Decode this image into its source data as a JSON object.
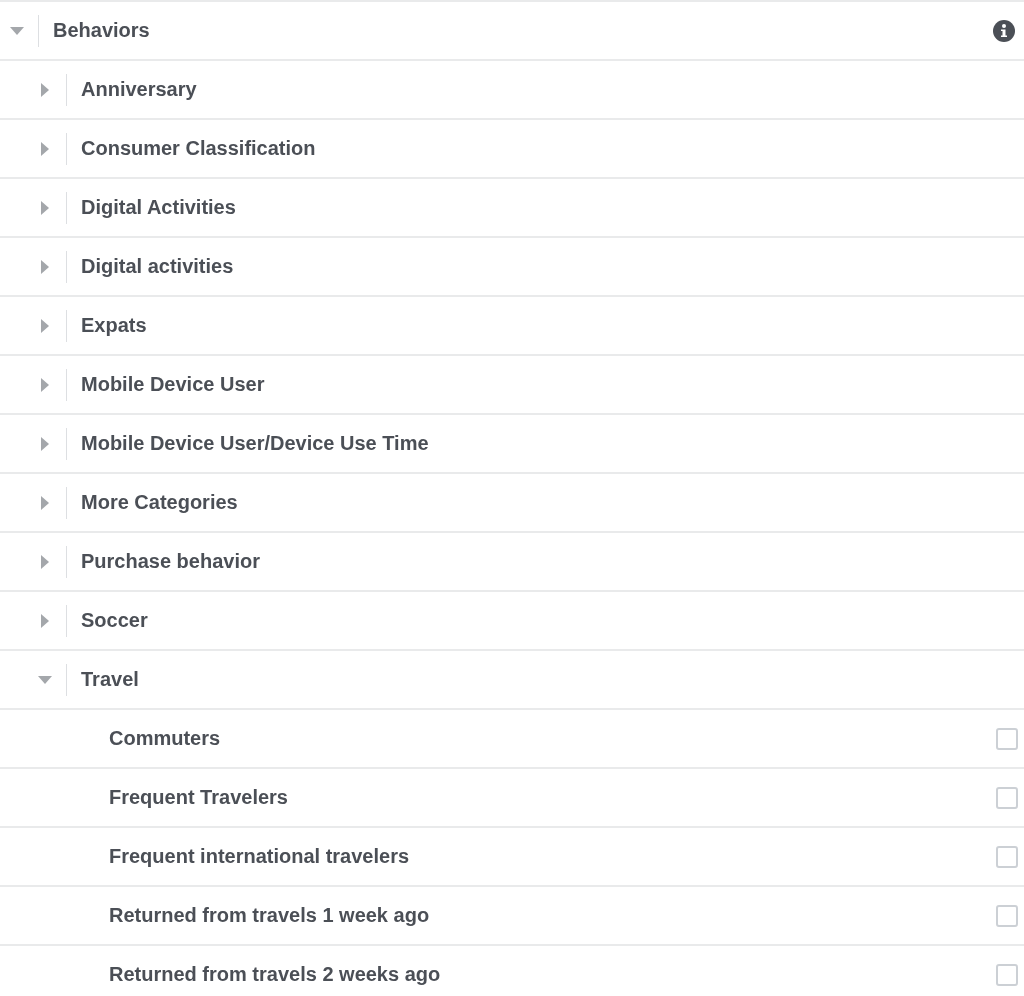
{
  "tree": [
    {
      "label": "Behaviors",
      "expanded": true,
      "children": [
        {
          "label": "Anniversary",
          "expanded": false
        },
        {
          "label": "Consumer Classification",
          "expanded": false
        },
        {
          "label": "Digital Activities",
          "expanded": false
        },
        {
          "label": "Digital activities",
          "expanded": false
        },
        {
          "label": "Expats",
          "expanded": false
        },
        {
          "label": "Mobile Device User",
          "expanded": false
        },
        {
          "label": "Mobile Device User/Device Use Time",
          "expanded": false
        },
        {
          "label": "More Categories",
          "expanded": false
        },
        {
          "label": "Purchase behavior",
          "expanded": false
        },
        {
          "label": "Soccer",
          "expanded": false
        },
        {
          "label": "Travel",
          "expanded": true,
          "children": [
            {
              "label": "Commuters",
              "checked": false
            },
            {
              "label": "Frequent Travelers",
              "checked": false
            },
            {
              "label": "Frequent international travelers",
              "checked": false
            },
            {
              "label": "Returned from travels 1 week ago",
              "checked": false
            },
            {
              "label": "Returned from travels 2 weeks ago",
              "checked": false
            }
          ]
        }
      ]
    }
  ]
}
